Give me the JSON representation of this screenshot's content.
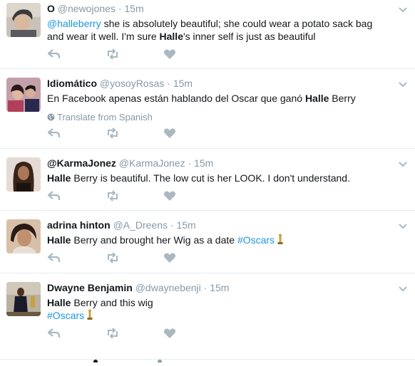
{
  "tweets": [
    {
      "fullname": "O",
      "handle": "@newojones",
      "time": "15m",
      "text_parts": [
        {
          "t": "@halleberry",
          "k": "link"
        },
        {
          "t": " she is absolutely beautiful; she could wear a potato sack bag and wear it well. I'm sure ",
          "k": "plain"
        },
        {
          "t": "Halle",
          "k": "bold"
        },
        {
          "t": "'s inner self is just as beautiful",
          "k": "plain"
        }
      ],
      "avatar_colors": [
        "#c8b8a8",
        "#3a3a3a"
      ]
    },
    {
      "fullname": "Idiomático",
      "handle": "@yosoyRosas",
      "time": "15m",
      "text_parts": [
        {
          "t": "En Facebook apenas están hablando del Oscar que ganó ",
          "k": "plain"
        },
        {
          "t": "Halle",
          "k": "bold"
        },
        {
          "t": " Berry",
          "k": "plain"
        }
      ],
      "translate": "Translate from Spanish",
      "avatar_colors": [
        "#b0405a",
        "#2a2a50"
      ]
    },
    {
      "fullname": "@KarmaJonez",
      "handle": "@KarmaJonez",
      "time": "15m",
      "text_parts": [
        {
          "t": "Halle",
          "k": "bold"
        },
        {
          "t": " Berry is beautiful. The low cut is her LOOK. I don't understand.",
          "k": "plain"
        }
      ],
      "avatar_colors": [
        "#d8c8b8",
        "#3a2418"
      ]
    },
    {
      "fullname": "adrina hinton",
      "handle": "@A_Dreens",
      "time": "15m",
      "text_parts": [
        {
          "t": "Halle",
          "k": "bold"
        },
        {
          "t": " Berry and brought her Wig as a date ",
          "k": "plain"
        },
        {
          "t": "#Oscars",
          "k": "link"
        }
      ],
      "oscar": true,
      "avatar_colors": [
        "#c09070",
        "#2a1a14"
      ]
    },
    {
      "fullname": "Dwayne Benjamin",
      "handle": "@dwaynebenji",
      "time": "15m",
      "text_parts": [
        {
          "t": "Halle",
          "k": "bold"
        },
        {
          "t": " Berry and this wig",
          "k": "plain"
        },
        {
          "t": "#Oscars",
          "k": "link",
          "br": true
        }
      ],
      "oscar": true,
      "avatar_colors": [
        "#b8b0a0",
        "#1a1a2a"
      ]
    }
  ],
  "icons": {
    "reply": "reply-icon",
    "retweet": "retweet-icon",
    "like": "heart-icon",
    "more": "chevron-down-icon",
    "translate": "globe-icon",
    "oscar": "oscar-statuette-icon"
  },
  "colors": {
    "link": "#1b95e0",
    "muted": "#8899a6",
    "icon": "#aab8c2",
    "divider": "#e6ecf0"
  }
}
